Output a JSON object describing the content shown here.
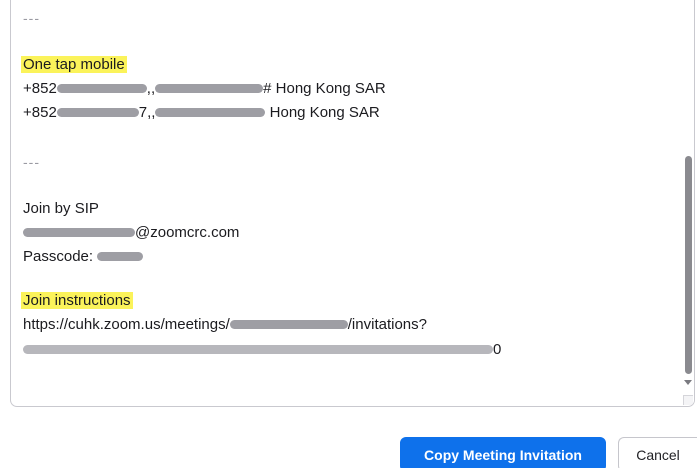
{
  "invitation": {
    "separator_1": "---",
    "one_tap_heading": "One tap mobile",
    "phone_1_prefix": "+852",
    "phone_1_suffix": "Hong Kong SAR",
    "phone_2_prefix": "+852",
    "phone_2_suffix": "Hong Kong SAR",
    "separator_2": "---",
    "join_sip_label": "Join by SIP",
    "sip_domain": "@zoomcrc.com",
    "passcode_label": "Passcode:",
    "join_instructions_heading": "Join instructions",
    "instructions_url_prefix": "https://cuhk.zoom.us/meetings/",
    "instructions_url_suffix": "/invitations?"
  },
  "highlight_color": "#fbf35a",
  "buttons": {
    "copy_label": "Copy Meeting Invitation",
    "cancel_label": "Cancel"
  },
  "colors": {
    "primary_button": "#0e71eb",
    "redaction": "#9e9ea4"
  }
}
